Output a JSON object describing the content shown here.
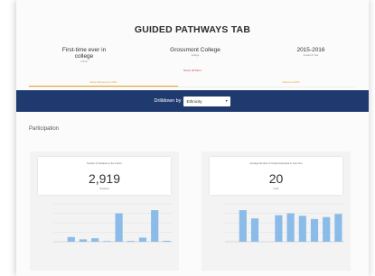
{
  "header": {
    "title": "GUIDED PATHWAYS TAB"
  },
  "filters": [
    {
      "value": "First-time ever in college",
      "label": "Cohort"
    },
    {
      "value": "Grossmont College",
      "label": "College"
    },
    {
      "value": "2015-2016",
      "label": "Academic Year"
    }
  ],
  "reset_label": "Reset all filters",
  "tabs": [
    {
      "label": "Early Momentum KPIs"
    },
    {
      "label": "Outcome KPIs"
    }
  ],
  "drilldown": {
    "label": "Drilldown by",
    "selected": "Ethnicity"
  },
  "section_title": "Participation",
  "cards": [
    {
      "title": "Number of Students in the Cohort",
      "value": "2,919",
      "unit": "Students",
      "chart_data": {
        "type": "bar",
        "categories": [
          "",
          "",
          "",
          "",
          "",
          "",
          "",
          "",
          "",
          ""
        ],
        "values": [
          0,
          150,
          75,
          110,
          20,
          900,
          25,
          130,
          1000,
          30
        ],
        "ylim": [
          0,
          1200
        ],
        "yticks": [
          "",
          "",
          "",
          "",
          ""
        ],
        "color": "#8bbbe8"
      }
    },
    {
      "title": "Average Number of Credits Attempted in Year One",
      "value": "20",
      "unit": "Units",
      "chart_data": {
        "type": "bar",
        "categories": [
          "",
          "",
          "",
          "",
          "",
          "",
          "",
          "",
          "",
          ""
        ],
        "values": [
          0,
          25,
          18.5,
          0,
          21,
          22.5,
          20.5,
          18,
          19.5,
          22
        ],
        "ylim": [
          0,
          30
        ],
        "yticks": [
          "",
          "",
          "",
          "",
          ""
        ],
        "color": "#8bbbe8"
      }
    }
  ]
}
